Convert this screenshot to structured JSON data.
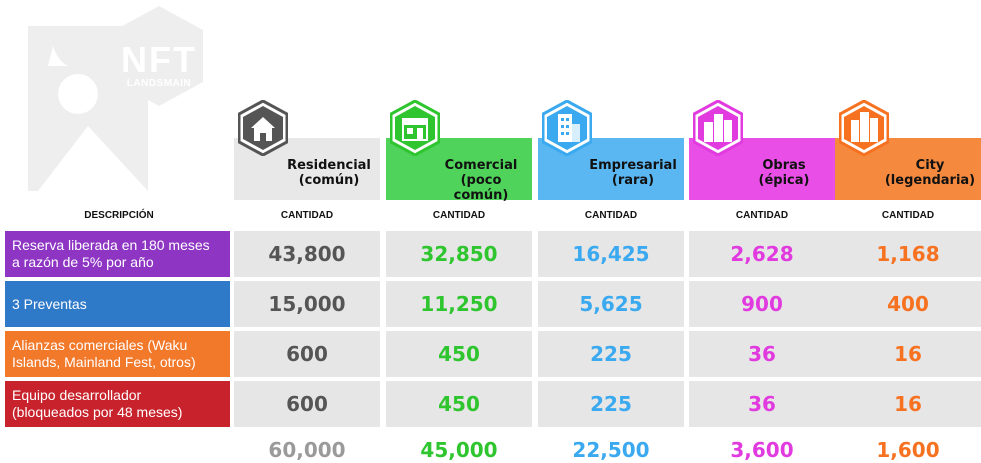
{
  "logo": {
    "text": "NFT",
    "subtext": "LANDSMAIN"
  },
  "header": {
    "descripcion": "DESCRIPCIÓN",
    "cantidad_label": "CANTIDAD"
  },
  "columns": [
    {
      "line1": "Residencial",
      "line2": "(común)",
      "icon": "house-icon",
      "color": "#555555",
      "bar": "#e8e8e8"
    },
    {
      "line1": "Comercial",
      "line2": "(poco común)",
      "icon": "store-icon",
      "color": "#2ec52e",
      "bar": "#4fd35a"
    },
    {
      "line1": "Empresarial",
      "line2": "(rara)",
      "icon": "office-building-icon",
      "color": "#3aa9ef",
      "bar": "#5ab7f2"
    },
    {
      "line1": "Obras",
      "line2": "(épica)",
      "icon": "city-buildings-icon",
      "color": "#e13adf",
      "bar": "#e94fe6"
    },
    {
      "line1": "City",
      "line2": "(legendaria)",
      "icon": "skyscraper-icon",
      "color": "#f77220",
      "bar": "#f58a3f"
    }
  ],
  "rows": [
    {
      "label_line1": "Reserva liberada en 180 meses",
      "label_line2": "a razón de 5% por año",
      "color": "#8e35c4",
      "values": [
        "43,800",
        "32,850",
        "16,425",
        "2,628",
        "1,168"
      ]
    },
    {
      "label_line1": "3 Preventas",
      "label_line2": "",
      "color": "#2f79c9",
      "values": [
        "15,000",
        "11,250",
        "5,625",
        "900",
        "400"
      ]
    },
    {
      "label_line1": "Alianzas comerciales (Waku",
      "label_line2": "Islands, Mainland Fest, otros)",
      "color": "#f2782a",
      "values": [
        "600",
        "450",
        "225",
        "36",
        "16"
      ]
    },
    {
      "label_line1": "Equipo desarrollador",
      "label_line2": "(bloqueados por 48 meses)",
      "color": "#c8232c",
      "values": [
        "600",
        "450",
        "225",
        "36",
        "16"
      ]
    }
  ],
  "totals": [
    "60,000",
    "45,000",
    "22,500",
    "3,600",
    "1,600"
  ],
  "value_colors": [
    "#555555",
    "#2ec52e",
    "#3aa9ef",
    "#e13adf",
    "#f77220"
  ],
  "total_colors": [
    "#9a9a9a",
    "#2ec52e",
    "#3aa9ef",
    "#e13adf",
    "#f77220"
  ]
}
